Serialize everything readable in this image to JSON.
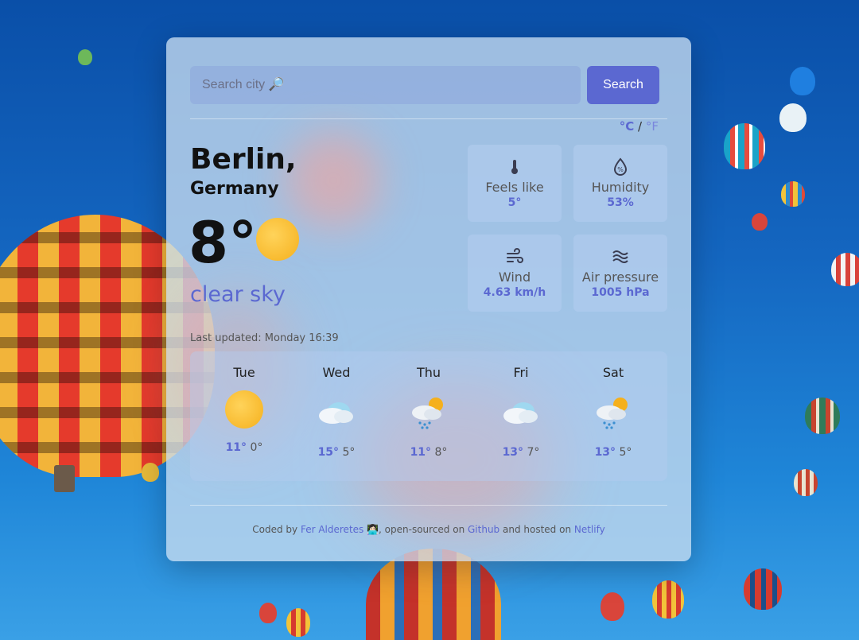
{
  "search": {
    "placeholder": "Search city 🔎",
    "button_label": "Search"
  },
  "units": {
    "celsius": "°C",
    "separator": "/",
    "fahrenheit": "°F"
  },
  "current": {
    "city": "Berlin,",
    "country": "Germany",
    "temperature": "8°",
    "icon": "sun-icon",
    "description": "clear sky",
    "last_updated": "Last updated: Monday 16:39"
  },
  "details": [
    {
      "icon": "thermometer-icon",
      "label": "Feels like",
      "value": "5°"
    },
    {
      "icon": "humidity-icon",
      "label": "Humidity",
      "value": "53%"
    },
    {
      "icon": "wind-icon",
      "label": "Wind",
      "value": "4.63 km/h"
    },
    {
      "icon": "air-pressure-icon",
      "label": "Air pressure",
      "value": "1005 hPa"
    }
  ],
  "forecast": [
    {
      "day": "Tue",
      "icon": "sun-icon",
      "high": "11°",
      "low": "0°"
    },
    {
      "day": "Wed",
      "icon": "cloud-icon",
      "high": "15°",
      "low": "5°"
    },
    {
      "day": "Thu",
      "icon": "rain-sun-icon",
      "high": "11°",
      "low": "8°"
    },
    {
      "day": "Fri",
      "icon": "cloud-icon",
      "high": "13°",
      "low": "7°"
    },
    {
      "day": "Sat",
      "icon": "rain-sun-icon",
      "high": "13°",
      "low": "5°"
    }
  ],
  "footer": {
    "prefix": "Coded by ",
    "author": "Fer Alderetes",
    "emoji": " 👩🏻‍💻",
    "middle1": ", open-sourced on ",
    "github": "Github",
    "middle2": " and hosted on ",
    "netlify": "Netlify"
  },
  "colors": {
    "accent": "#5b68d1",
    "card": "#c8dcf0"
  }
}
